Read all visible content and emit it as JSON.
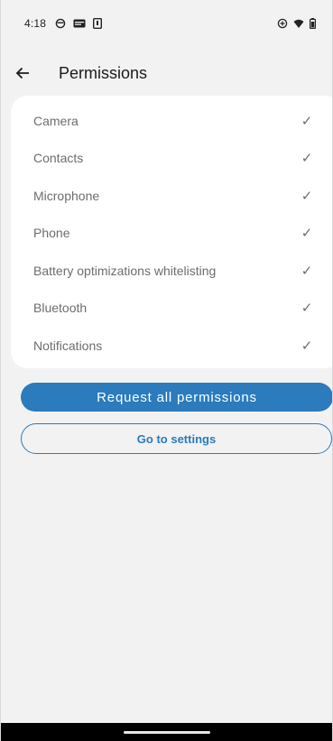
{
  "status_bar": {
    "time": "4:18",
    "left_icons": [
      "vpn-key-icon",
      "news-icon",
      "sim-card-icon"
    ],
    "right_icons": [
      "data-saver-icon",
      "wifi-icon",
      "battery-icon"
    ]
  },
  "app_bar": {
    "back_icon": "arrow-back-icon",
    "title": "Permissions"
  },
  "permissions": [
    {
      "label": "Camera",
      "granted": true
    },
    {
      "label": "Contacts",
      "granted": true
    },
    {
      "label": "Microphone",
      "granted": true
    },
    {
      "label": "Phone",
      "granted": true
    },
    {
      "label": "Battery optimizations whitelisting",
      "granted": true
    },
    {
      "label": "Bluetooth",
      "granted": true
    },
    {
      "label": "Notifications",
      "granted": true
    }
  ],
  "check_glyph": "✓",
  "buttons": {
    "request_all": "Request all permissions",
    "go_to_settings": "Go to settings"
  },
  "colors": {
    "accent": "#2b7bbd",
    "background": "#f2f2f2",
    "card": "#ffffff",
    "secondary_text": "#6d6d6d"
  }
}
